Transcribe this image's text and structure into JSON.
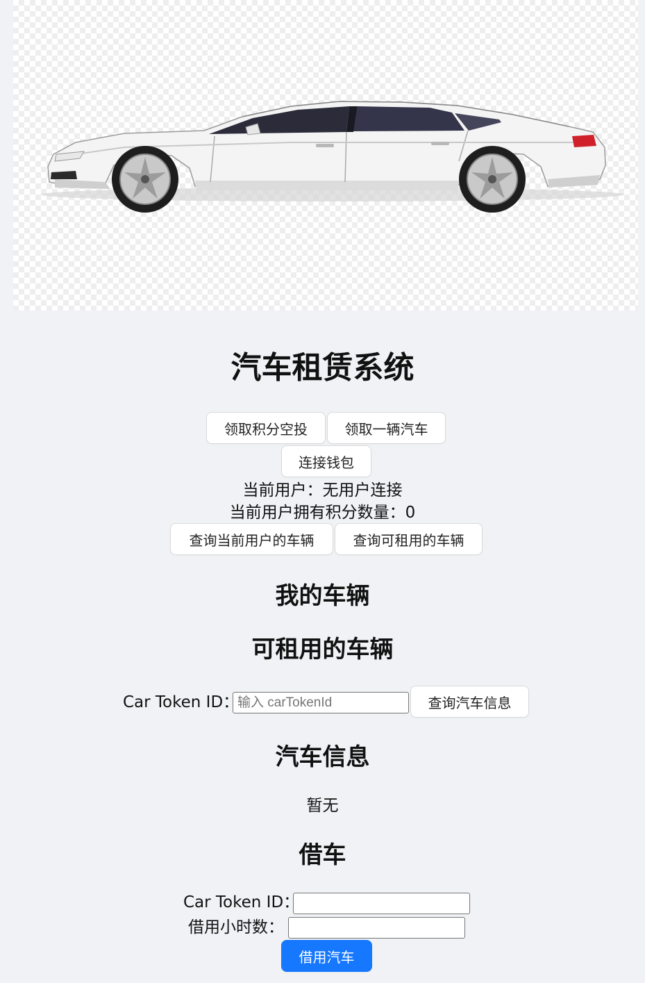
{
  "app": {
    "title": "汽车租赁系统"
  },
  "hero": {
    "image": "white-sedan-car"
  },
  "actions": {
    "claim_airdrop": "领取积分空投",
    "claim_car": "领取一辆汽车",
    "connect_wallet": "连接钱包",
    "query_my_cars": "查询当前用户的车辆",
    "query_available_cars": "查询可租用的车辆"
  },
  "status": {
    "current_user_label": "当前用户：",
    "current_user_value": "无用户连接",
    "points_label": "当前用户拥有积分数量：",
    "points_value": "0"
  },
  "sections": {
    "my_cars": "我的车辆",
    "available_cars": "可租用的车辆",
    "car_info": "汽车信息",
    "borrow": "借车"
  },
  "query": {
    "label": "Car Token ID：",
    "placeholder": "输入 carTokenId",
    "button": "查询汽车信息"
  },
  "car_info": {
    "empty_text": "暂无"
  },
  "borrow_form": {
    "token_label": "Car Token ID：",
    "hours_label": "借用小时数：",
    "submit": "借用汽车"
  },
  "colors": {
    "primary": "#1677ff",
    "background": "#f0f2f5"
  }
}
